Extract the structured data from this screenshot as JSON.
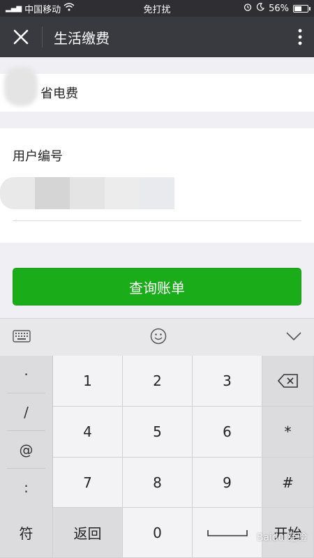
{
  "status_bar": {
    "carrier": "中国移动",
    "dnd": "免打扰",
    "battery": "56%",
    "battery_level": 0.56
  },
  "navbar": {
    "title": "生活缴费"
  },
  "form": {
    "bill_type_label": "省电费",
    "user_id_label": "用户编号",
    "query_button": "查询账单"
  },
  "keyboard": {
    "side_keys": [
      "·",
      "/",
      "@",
      ":"
    ],
    "digits": [
      "1",
      "2",
      "3",
      "4",
      "5",
      "6",
      "7",
      "8",
      "9"
    ],
    "star": "*",
    "hash": "#",
    "symbol": "符",
    "back": "返回",
    "zero": "0",
    "start": "开始"
  },
  "watermark": "Baidu 经验"
}
